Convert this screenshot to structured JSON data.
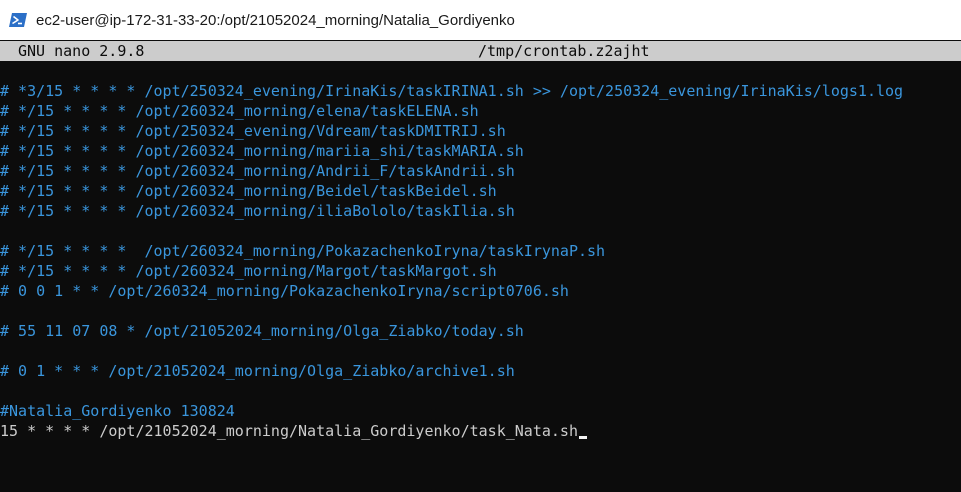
{
  "window": {
    "title": "ec2-user@ip-172-31-33-20:/opt/21052024_morning/Natalia_Gordiyenko"
  },
  "nano": {
    "version": "GNU nano 2.9.8",
    "filename": "/tmp/crontab.z2ajht"
  },
  "editor": {
    "lines": [
      {
        "text": "# *3/15 * * * * /opt/250324_evening/IrinaKis/taskIRINA1.sh >> /opt/250324_evening/IrinaKis/logs1.log",
        "kind": "comment"
      },
      {
        "text": "# */15 * * * * /opt/260324_morning/elena/taskELENA.sh",
        "kind": "comment"
      },
      {
        "text": "# */15 * * * * /opt/250324_evening/Vdream/taskDMITRIJ.sh",
        "kind": "comment"
      },
      {
        "text": "# */15 * * * * /opt/260324_morning/mariia_shi/taskMARIA.sh",
        "kind": "comment"
      },
      {
        "text": "# */15 * * * * /opt/260324_morning/Andrii_F/taskAndrii.sh",
        "kind": "comment"
      },
      {
        "text": "# */15 * * * * /opt/260324_morning/Beidel/taskBeidel.sh",
        "kind": "comment"
      },
      {
        "text": "# */15 * * * * /opt/260324_morning/iliaBololo/taskIlia.sh",
        "kind": "comment"
      },
      {
        "text": "",
        "kind": "blank"
      },
      {
        "text": "# */15 * * * *  /opt/260324_morning/PokazachenkoIryna/taskIrynaP.sh",
        "kind": "comment"
      },
      {
        "text": "# */15 * * * * /opt/260324_morning/Margot/taskMargot.sh",
        "kind": "comment"
      },
      {
        "text": "# 0 0 1 * * /opt/260324_morning/PokazachenkoIryna/script0706.sh",
        "kind": "comment"
      },
      {
        "text": "",
        "kind": "blank"
      },
      {
        "text": "# 55 11 07 08 * /opt/21052024_morning/Olga_Ziabko/today.sh",
        "kind": "comment"
      },
      {
        "text": "",
        "kind": "blank"
      },
      {
        "text": "# 0 1 * * * /opt/21052024_morning/Olga_Ziabko/archive1.sh",
        "kind": "comment"
      },
      {
        "text": "",
        "kind": "blank"
      },
      {
        "text": "#Natalia_Gordiyenko 130824",
        "kind": "comment"
      },
      {
        "text": "15 * * * * /opt/21052024_morning/Natalia_Gordiyenko/task_Nata.sh",
        "kind": "plain",
        "cursor": true
      }
    ]
  },
  "colors": {
    "comment": "#3a96dd",
    "plain": "#cccccc",
    "header_bg": "#cccccc",
    "terminal_bg": "#0c0c0c"
  },
  "icons": {
    "app": "powershell-icon"
  }
}
